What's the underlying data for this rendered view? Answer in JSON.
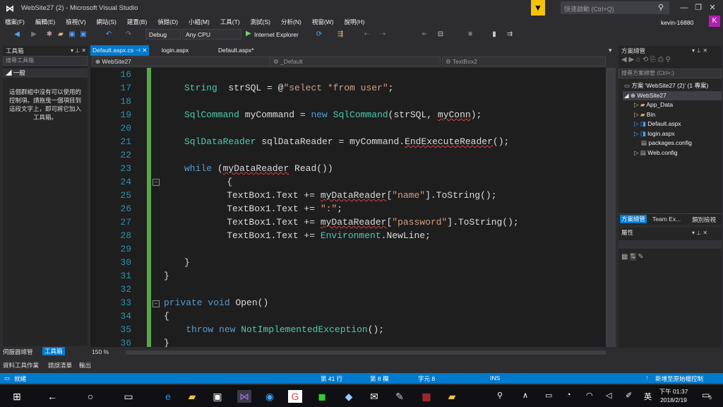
{
  "window": {
    "title": "WebSite27 (2) - Microsoft Visual Studio",
    "quick_launch_placeholder": "快速啟動 (Ctrl+Q)",
    "profile_initial": "K",
    "user": "kevin-16880"
  },
  "menu": [
    "檔案(F)",
    "編輯(E)",
    "檢視(V)",
    "網站(S)",
    "建置(B)",
    "偵錯(D)",
    "小組(M)",
    "工具(T)",
    "測試(S)",
    "分析(N)",
    "視窗(W)",
    "說明(H)"
  ],
  "toolbar": {
    "config": "Debug",
    "platform": "Any CPU",
    "run_label": "Internet Explorer"
  },
  "toolbox": {
    "title": "工具箱",
    "search_placeholder": "搜尋工具箱",
    "group": "一般",
    "empty_message": "這個群組中沒有可以使用的控制項。請拖曳一個項目到這段文字上，即可將它加入工具箱。",
    "tabs": [
      "伺服器總管",
      "工具箱"
    ],
    "bottom_tabs": [
      "資料工具作業",
      "錯誤清單",
      "輸出"
    ]
  },
  "editor": {
    "tabs": [
      "Default.aspx.cs",
      "login.aspx",
      "Default.aspx*"
    ],
    "nav": [
      "WebSite27",
      "_Default",
      "TextBox2"
    ],
    "zoom": "150 %"
  },
  "code_lines": [
    {
      "n": "16",
      "segs": []
    },
    {
      "n": "17",
      "segs": [
        [
          "ty",
          "String"
        ],
        [
          "",
          "  strSQL = @"
        ],
        [
          "st",
          "\"select *from user\""
        ],
        [
          "",
          ";"
        ]
      ]
    },
    {
      "n": "18",
      "segs": []
    },
    {
      "n": "19",
      "segs": [
        [
          "ty",
          "SqlCommand"
        ],
        [
          "",
          " myCommand = "
        ],
        [
          "kw",
          "new"
        ],
        [
          "",
          " "
        ],
        [
          "ty",
          "SqlCommand"
        ],
        [
          "",
          "(strSQL, "
        ],
        [
          "wavy",
          "myConn"
        ],
        [
          "",
          ");"
        ]
      ]
    },
    {
      "n": "20",
      "segs": []
    },
    {
      "n": "21",
      "segs": [
        [
          "ty",
          "SqlDataReader"
        ],
        [
          "",
          " sqlDataReader = myCommand."
        ],
        [
          "wavy",
          "EndExecuteReader"
        ],
        [
          "",
          "();"
        ]
      ]
    },
    {
      "n": "22",
      "segs": []
    },
    {
      "n": "23",
      "segs": [
        [
          "kw",
          "while"
        ],
        [
          "",
          " ("
        ],
        [
          "wavy",
          "myDataReader"
        ],
        [
          "",
          " Read())"
        ]
      ]
    },
    {
      "n": "24",
      "segs": [
        [
          "",
          "    {"
        ]
      ]
    },
    {
      "n": "25",
      "segs": [
        [
          "",
          "    TextBox1.Text += "
        ],
        [
          "wavy",
          "myDataReader"
        ],
        [
          "",
          "["
        ],
        [
          "st",
          "\"name\""
        ],
        [
          "",
          "].ToString();"
        ]
      ]
    },
    {
      "n": "26",
      "segs": [
        [
          "",
          "    TextBox1.Text += "
        ],
        [
          "st",
          "\":\""
        ],
        [
          "",
          ";"
        ]
      ]
    },
    {
      "n": "27",
      "segs": [
        [
          "",
          "    TextBox1.Text += "
        ],
        [
          "wavy",
          "myDataReader"
        ],
        [
          "",
          "["
        ],
        [
          "st",
          "\"password\""
        ],
        [
          "",
          "].ToString();"
        ]
      ]
    },
    {
      "n": "28",
      "segs": [
        [
          "",
          "    TextBox1.Text += "
        ],
        [
          "ty",
          "Environment"
        ],
        [
          "",
          ".NewLine;"
        ]
      ]
    },
    {
      "n": "29",
      "segs": []
    },
    {
      "n": "30",
      "segs": [
        [
          "",
          "}"
        ]
      ]
    },
    {
      "n": "31",
      "segs": [
        [
          "",
          "}"
        ]
      ]
    },
    {
      "n": "32",
      "segs": []
    },
    {
      "n": "33",
      "segs": [
        [
          "kw",
          "private"
        ],
        [
          "",
          " "
        ],
        [
          "kw",
          "void"
        ],
        [
          "",
          " Open()"
        ]
      ]
    },
    {
      "n": "34",
      "segs": [
        [
          "",
          "{"
        ]
      ]
    },
    {
      "n": "35",
      "segs": [
        [
          "",
          "    "
        ],
        [
          "kw",
          "throw"
        ],
        [
          "",
          " "
        ],
        [
          "kw",
          "new"
        ],
        [
          "",
          " "
        ],
        [
          "ty",
          "NotImplementedException"
        ],
        [
          "",
          "();"
        ]
      ]
    },
    {
      "n": "36",
      "segs": [
        [
          "",
          "}"
        ]
      ]
    }
  ],
  "solution": {
    "title": "方案總管",
    "search_placeholder": "搜尋方案總管 (Ctrl+;)",
    "root": "方案 'WebSite27 (2)' (1 專案)",
    "project": "WebSite27",
    "items": [
      "App_Data",
      "Bin",
      "Default.aspx",
      "login.aspx",
      "packages.config",
      "Web.config"
    ],
    "tabs": [
      "方案總管",
      "Team Ex...",
      "類別檢視"
    ]
  },
  "properties": {
    "title": "屬性"
  },
  "status": {
    "ready": "就緒",
    "line": "第 41 行",
    "col": "第 8 欄",
    "ch": "字元 8",
    "ins": "INS",
    "publish": "新增至原始檔控制"
  },
  "taskbar": {
    "time": "下午 01:37",
    "date": "2018/2/19",
    "ime": "英",
    "notif_count": "5"
  }
}
